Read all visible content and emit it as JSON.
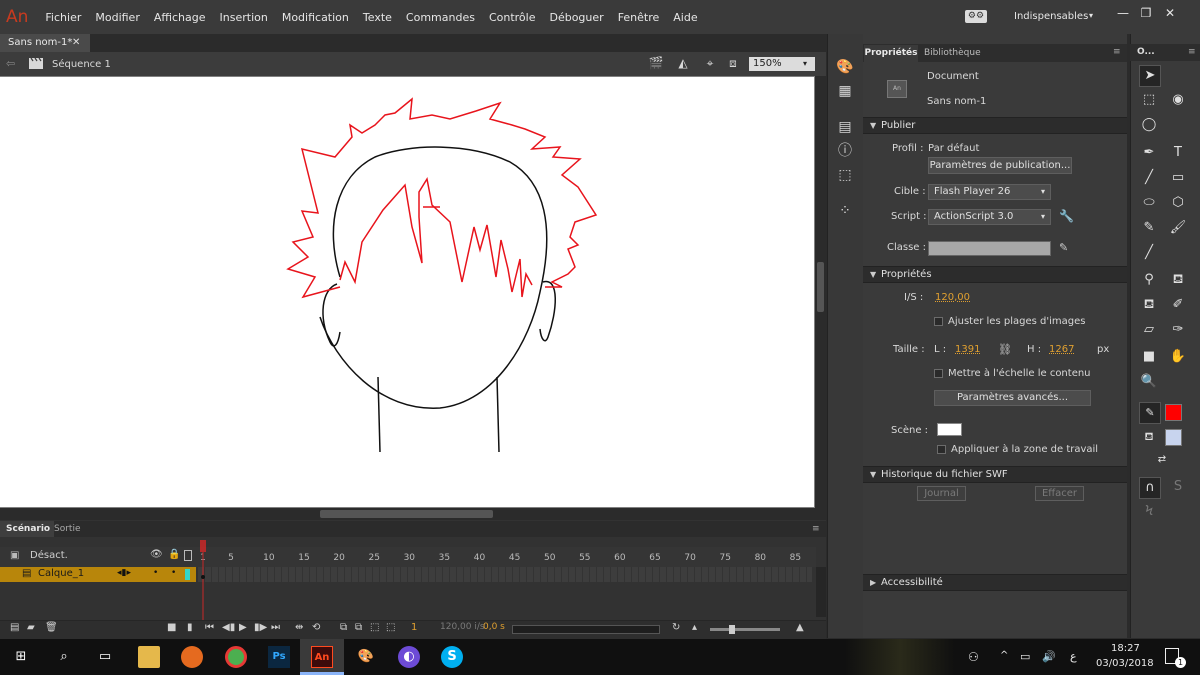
{
  "app": {
    "logo": "An"
  },
  "menu": [
    "Fichier",
    "Modifier",
    "Affichage",
    "Insertion",
    "Modification",
    "Texte",
    "Commandes",
    "Contrôle",
    "Déboguer",
    "Fenêtre",
    "Aide"
  ],
  "workspace": {
    "label": "Indispensables",
    "arrow": "▾"
  },
  "window_buttons": {
    "minimize": "—",
    "restore": "❐",
    "close": "✕"
  },
  "document_tab": {
    "title": "Sans nom-1*",
    "close": "✕"
  },
  "scene_bar": {
    "label": "Séquence 1",
    "zoom": "150%",
    "zoom_arrow": "▾"
  },
  "timeline": {
    "tabs": [
      "Scénario",
      "Sortie"
    ],
    "header_label": "Désact.",
    "layer_name": "Calque_1",
    "ruler": [
      "1",
      "5",
      "10",
      "15",
      "20",
      "25",
      "30",
      "35",
      "40",
      "45",
      "50",
      "55",
      "60",
      "65",
      "70",
      "75",
      "80",
      "85"
    ],
    "current_frame": "1",
    "fps": "120,00 i/s",
    "time": "0,0 s"
  },
  "properties_panel": {
    "tabs": [
      "Propriétés",
      "Bibliothèque"
    ],
    "doc_type": "Document",
    "doc_name": "Sans nom-1",
    "doc_icon": "An",
    "sections": {
      "publish": "Publier",
      "properties": "Propriétés",
      "swf_history": "Historique du fichier SWF",
      "accessibility": "Accessibilité"
    },
    "profile_label": "Profil :",
    "profile_value": "Par défaut",
    "publish_settings_button": "Paramètres de publication...",
    "target_label": "Cible :",
    "target_value": "Flash Player 26",
    "script_label": "Script :",
    "script_value": "ActionScript 3.0",
    "class_label": "Classe :",
    "fps_label": "I/S :",
    "fps_value": "120,00",
    "adjust_frames_label": "Ajuster les plages d'images",
    "size_label": "Taille :",
    "width_label": "L :",
    "width_value": "1391",
    "height_label": "H :",
    "height_value": "1267",
    "unit": "px",
    "scale_content_label": "Mettre à l'échelle le contenu",
    "advanced_button": "Paramètres avancés...",
    "stage_label": "Scène :",
    "apply_workspace_label": "Appliquer à la zone de travail",
    "journal_button": "Journal",
    "clear_button": "Effacer",
    "stage_color": "#ffffff"
  },
  "tools_panel": {
    "title": "O...",
    "stroke_color": "#ff0000",
    "fill_color": "#c8d4ee"
  },
  "taskbar": {
    "time": "18:27",
    "date": "03/03/2018",
    "lang": "ع",
    "notif_count": "1"
  },
  "drawing": {
    "hair_color": "#e8141c",
    "face_color": "#111111"
  }
}
